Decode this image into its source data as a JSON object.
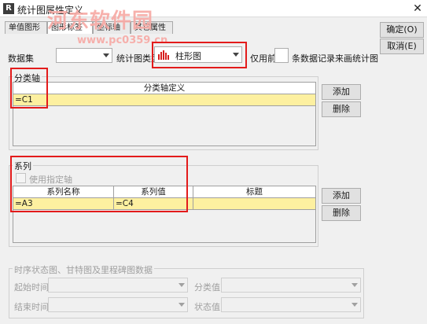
{
  "window": {
    "title": "统计图属性定义",
    "icon_glyph": "R",
    "close_glyph": "✕"
  },
  "watermark": {
    "main": "河东软件园",
    "url": "www.pc0359.cn"
  },
  "tabs": [
    "单值图形",
    "图形标签",
    "坐标轴",
    "其它属性"
  ],
  "buttons": {
    "ok": "确定(O)",
    "cancel": "取消(E)"
  },
  "top_row": {
    "dataset_label": "数据集",
    "dataset_value": "",
    "chart_type_label": "统计图类型",
    "chart_type_value": "柱形图",
    "chart_type_icon": "bar-chart-icon",
    "only_first_label": "仅用前",
    "record_count_value": "",
    "records_suffix": "条数据记录来画统计图"
  },
  "category_axis": {
    "group_title": "分类轴",
    "column_header": "分类轴定义",
    "rows": [
      "=C1"
    ],
    "add": "添加",
    "delete": "删除"
  },
  "series": {
    "group_title": "系列",
    "use_axis_label": "使用指定轴",
    "headers": [
      "系列名称",
      "系列值",
      "标题"
    ],
    "rows": [
      [
        "=A3",
        "=C4",
        ""
      ]
    ],
    "add": "添加",
    "delete": "删除"
  },
  "timeline": {
    "group_title": "时序状态图、甘特图及里程碑图数据",
    "start_time_label": "起始时间",
    "category_value_label": "分类值",
    "end_time_label": "结束时间",
    "status_value_label": "状态值"
  },
  "colors": {
    "highlight": "#e31b1b",
    "selected_row": "#fdf0a0",
    "watermark": "#f7a9a4"
  }
}
